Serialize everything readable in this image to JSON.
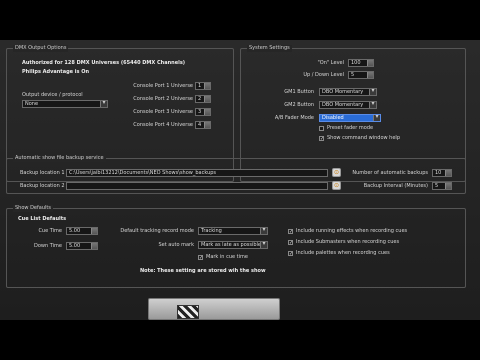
{
  "dmx": {
    "title": "DMX Output Options",
    "authorized_line": "Authorized for 128 DMX Universes (65440 DMX Channels)",
    "advantage_line": "Philips Advantage is On",
    "output_device_label": "Output device / protocol",
    "output_device_value": "None",
    "ports": [
      {
        "label": "Console Port 1 Universe",
        "value": "1"
      },
      {
        "label": "Console Port 2 Universe",
        "value": "2"
      },
      {
        "label": "Console Port 3 Universe",
        "value": "3"
      },
      {
        "label": "Console Port 4 Universe",
        "value": "4"
      }
    ]
  },
  "system": {
    "title": "System Settings",
    "on_level_label": "\"On\" Level",
    "on_level_value": "100",
    "updown_label": "Up / Down Level",
    "updown_value": "5",
    "gm1_label": "GM1 Button",
    "gm1_value": "DBO Momentary",
    "gm2_label": "GM2 Button",
    "gm2_value": "DBO Momentary",
    "ab_label": "A/B Fader Mode",
    "ab_value": "Disabled",
    "preset_fader": "Preset fader mode",
    "show_help": "Show command window help"
  },
  "backup": {
    "title": "Automatic show file backup service",
    "loc1_label": "Backup location 1",
    "loc1_value": "C:\\Users\\jaibi13212\\Documents\\NEO Shows\\show_backups",
    "loc2_label": "Backup location 2",
    "loc2_value": "",
    "num_label": "Number of automatic backups",
    "num_value": "10",
    "interval_label": "Backup Interval (Minutes)",
    "interval_value": "5"
  },
  "show": {
    "title": "Show Defaults",
    "cue_list_title": "Cue List Defaults",
    "cue_time_label": "Cue Time",
    "cue_time_value": "5.00",
    "down_time_label": "Down Time",
    "down_time_value": "5.00",
    "tracking_label": "Default tracking record mode",
    "tracking_value": "Tracking",
    "automark_label": "Set auto mark",
    "automark_value": "Mark as late as possible",
    "mark_in_cue": "Mark in cue time",
    "include_effects": "Include running effects when recording cues",
    "include_submasters": "Include Submasters when recording cues",
    "include_palettes": "Include palettes when recording cues",
    "note": "Note: These setting are stored wih the show"
  },
  "icons": {
    "browse": "folder-browse-icon",
    "check": "✓",
    "clapper": "clapperboard-icon"
  }
}
